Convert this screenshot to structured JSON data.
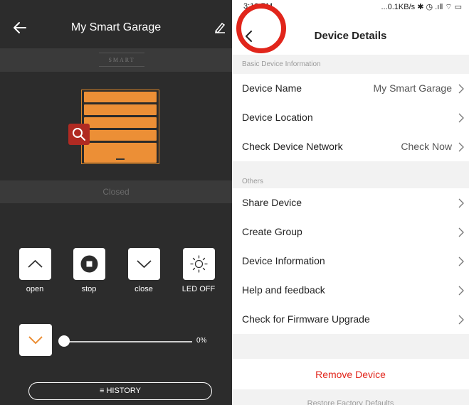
{
  "left": {
    "title": "My Smart Garage",
    "brand": "SMART",
    "status": "Closed",
    "controls": [
      {
        "label": "open",
        "icon": "chevron-up-icon"
      },
      {
        "label": "stop",
        "icon": "stop-icon"
      },
      {
        "label": "close",
        "icon": "chevron-down-icon"
      },
      {
        "label": "LED OFF",
        "icon": "sun-icon"
      }
    ],
    "slider_value": "0%",
    "slider_fraction": 0,
    "history": "≡ HISTORY",
    "colors": {
      "door": "#ec8f36",
      "background": "#2c2c2c"
    }
  },
  "right": {
    "statusbar": {
      "time": "3:10 PM",
      "system": "...0.1KB/s ✱ ◷ .ıll ⌔ ▭"
    },
    "title": "Device Details",
    "section1": "Basic Device Information",
    "rows1": [
      {
        "label": "Device Name",
        "value": "My Smart Garage"
      },
      {
        "label": "Device Location",
        "value": ""
      },
      {
        "label": "Check Device Network",
        "value": "Check Now"
      }
    ],
    "section2": "Others",
    "rows2": [
      {
        "label": "Share Device"
      },
      {
        "label": "Create Group"
      },
      {
        "label": "Device Information"
      },
      {
        "label": "Help and feedback"
      },
      {
        "label": "Check for Firmware Upgrade"
      }
    ],
    "remove": "Remove Device",
    "restore": "Restore Factory Defaults",
    "colors": {
      "accent": "#e1251b"
    }
  }
}
